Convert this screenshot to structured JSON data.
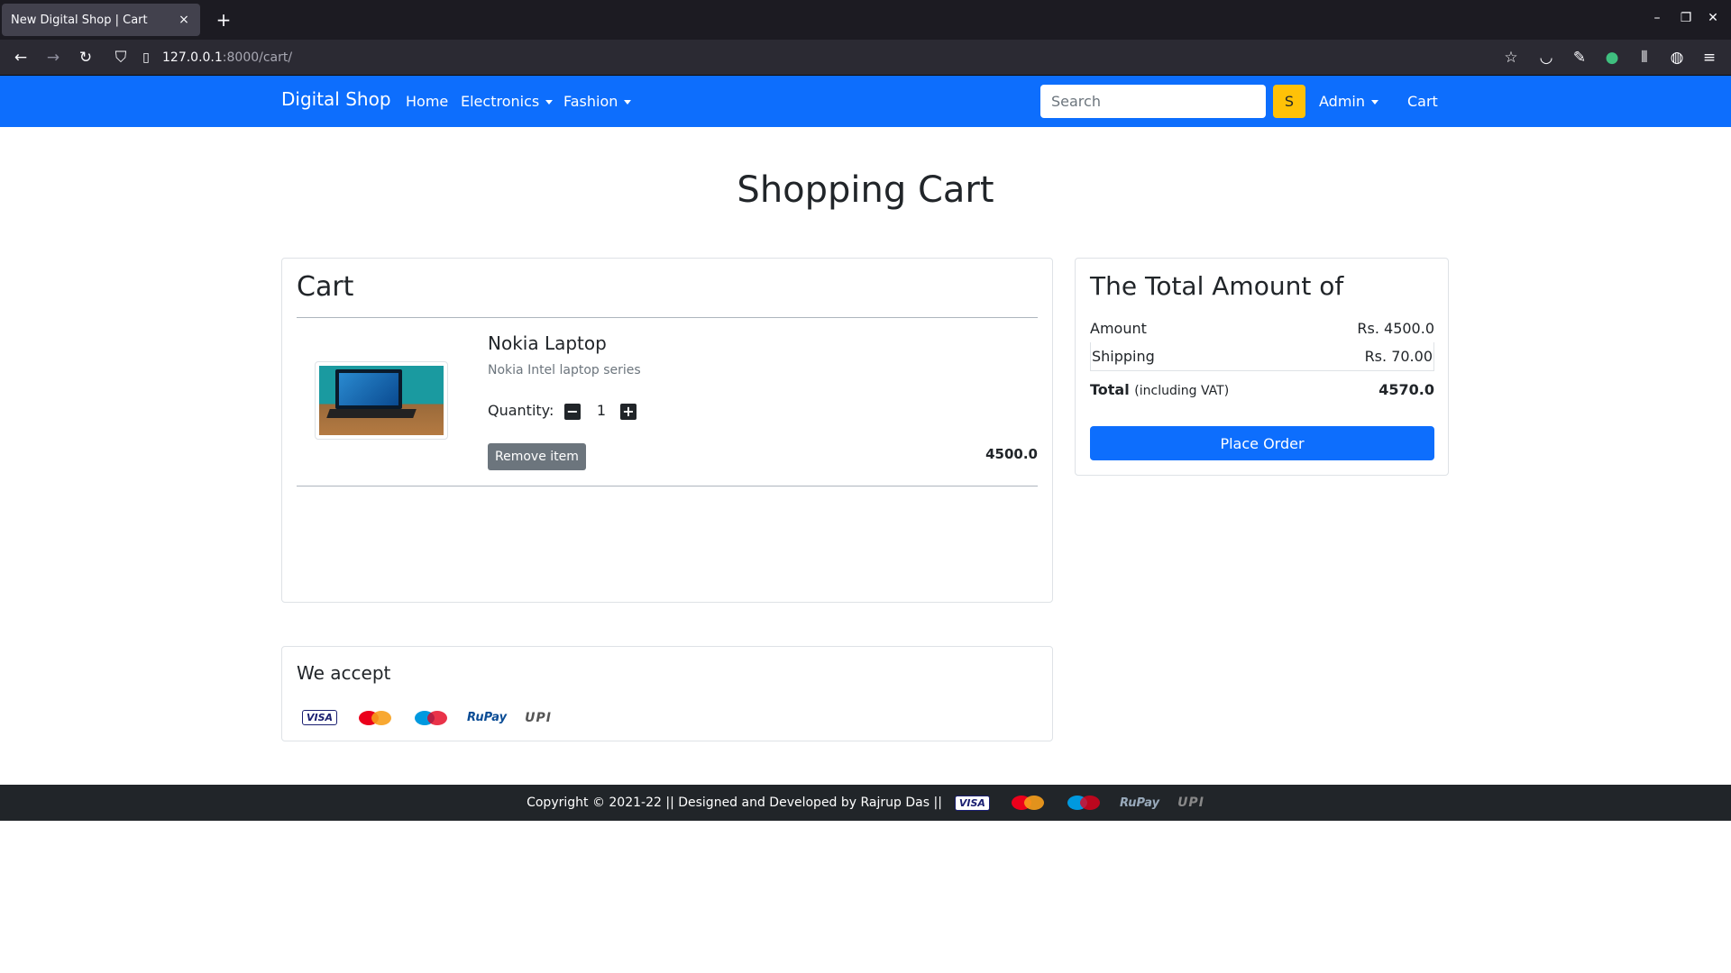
{
  "browser": {
    "tab_title": "New Digital Shop | Cart",
    "tab_close": "×",
    "new_tab": "+",
    "url_host": "127.0.0.1",
    "url_path": ":8000/cart/"
  },
  "nav": {
    "brand": "Digital Shop",
    "home": "Home",
    "electronics": "Electronics",
    "fashion": "Fashion",
    "search_placeholder": "Search",
    "search_button": "S",
    "admin": "Admin",
    "cart": "Cart"
  },
  "page": {
    "title": "Shopping Cart"
  },
  "cart": {
    "heading": "Cart",
    "items": [
      {
        "name": "Nokia Laptop",
        "description": "Nokia Intel laptop series",
        "quantity_label": "Quantity:",
        "quantity": "1",
        "remove_label": "Remove item",
        "price": "4500.0"
      }
    ]
  },
  "summary": {
    "heading": "The Total Amount of",
    "amount_label": "Amount",
    "amount_value": "Rs. 4500.0",
    "shipping_label": "Shipping",
    "shipping_value": "Rs. 70.00",
    "total_label": "Total",
    "total_note": "(including VAT)",
    "total_value": "4570.0",
    "place_order": "Place Order"
  },
  "accept": {
    "heading": "We accept",
    "methods": [
      "VISA",
      "MasterCard",
      "Maestro",
      "RuPay",
      "UPI"
    ]
  },
  "footer": {
    "text": "Copyright © 2021-22 || Designed and Developed by Rajrup Das ||"
  },
  "colors": {
    "primary": "#0d6efd",
    "warning": "#ffc107",
    "secondary": "#6c757d",
    "dark": "#212529"
  }
}
